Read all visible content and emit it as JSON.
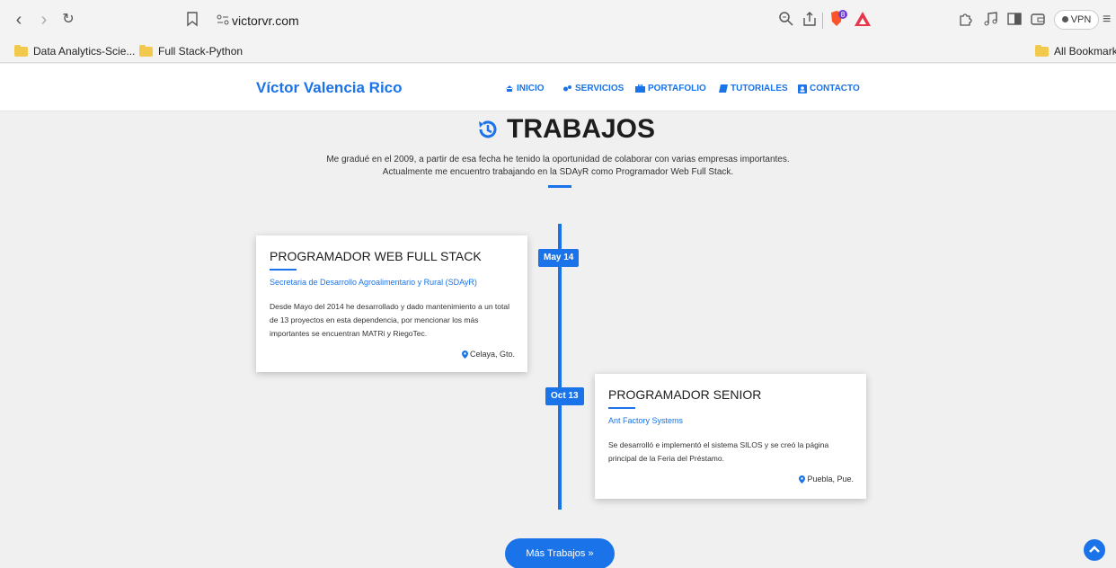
{
  "browser": {
    "url": "victorvr.com",
    "vpn_label": "VPN",
    "bookmarks": [
      "Data Analytics-Scie...",
      "Full Stack-Python"
    ],
    "all_bookmarks_label": "All Bookmarks",
    "shield_badge": "8"
  },
  "site": {
    "brand": "Víctor Valencia Rico",
    "menu": [
      "INICIO",
      "SERVICIOS",
      "PORTAFOLIO",
      "TUTORIALES",
      "CONTACTO"
    ]
  },
  "section": {
    "title": "TRABAJOS",
    "intro_line1": "Me gradué en el 2009, a partir de esa fecha he tenido la oportunidad de colaborar con varias empresas importantes.",
    "intro_line2": "Actualmente me encuentro trabajando en la SDAyR como Programador Web Full Stack."
  },
  "jobs": [
    {
      "date": "May 14",
      "title": "PROGRAMADOR WEB FULL STACK",
      "company": "Secretaria de Desarrollo Agroalimentario y Rural (SDAyR)",
      "description": "Desde Mayo del 2014 he desarrollado y dado mantenimiento a un total de 13 proyectos en esta dependencia, por mencionar los más importantes se encuentran MATRi y RiegoTec.",
      "location": "Celaya, Gto."
    },
    {
      "date": "Oct 13",
      "title": "PROGRAMADOR SENIOR",
      "company": "Ant Factory Systems",
      "description": "Se desarrolló e implementó el sistema SILOS y se creó la página principal de la Feria del Préstamo.",
      "location": "Puebla, Pue."
    }
  ],
  "more_button": "Más Trabajos »",
  "colors": {
    "accent": "#1a73e8",
    "background": "#f0f0f0"
  }
}
